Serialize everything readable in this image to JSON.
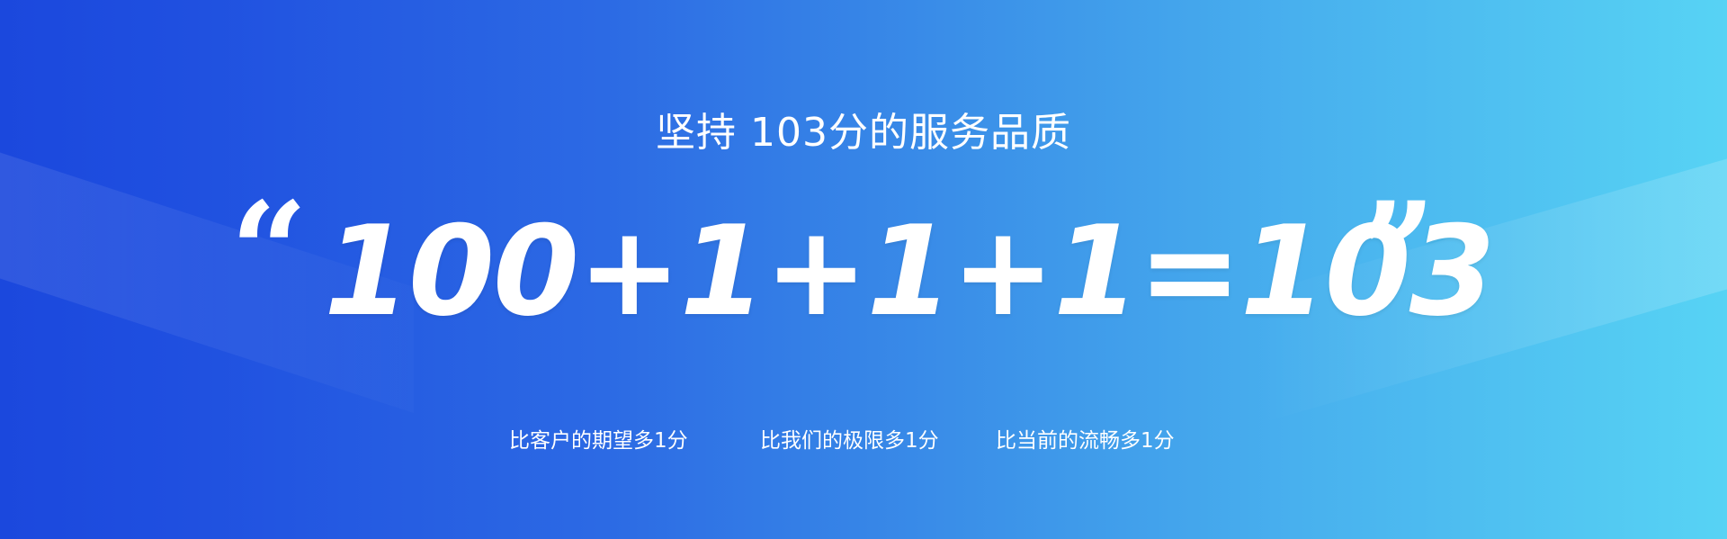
{
  "banner": {
    "headline": "坚持 103分的服务品质",
    "formula": "100+1+1+1=103",
    "open_quote": "“",
    "close_quote": "”",
    "taglines": [
      "比客户的期望多1分",
      "比我们的极限多1分",
      "比当前的流畅多1分"
    ],
    "colors": {
      "gradient_start": "#1b48dd",
      "gradient_end": "#57d3f4",
      "text": "#ffffff"
    }
  }
}
